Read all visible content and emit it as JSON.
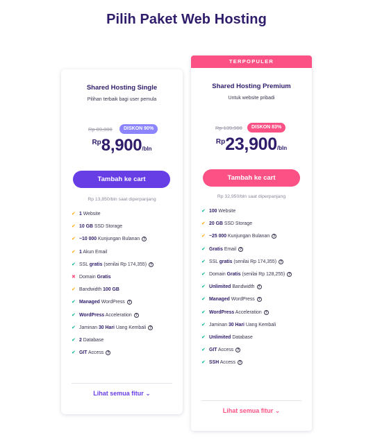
{
  "page": {
    "title": "Pilih Paket Web Hosting"
  },
  "colors": {
    "brand_purple": "#673de6",
    "accent_pink": "#fc5185",
    "title_navy": "#2f1c6a",
    "check_green": "#00b090",
    "check_orange": "#ffa800"
  },
  "plans": [
    {
      "name": "Shared Hosting Single",
      "description": "Pilihan terbaik bagi user pemula",
      "old_price": "Rp 89,000",
      "discount": "DISKON 90%",
      "currency": "Rp",
      "price": "8,900",
      "period": "/bln",
      "cta": "Tambah ke cart",
      "renewal": "Rp 13,850/bln saat diperpanjang",
      "see_all": "Lihat semua fitur",
      "features": [
        {
          "icon": "orange-check-icon",
          "bold": "1",
          "text": " Website",
          "help": false
        },
        {
          "icon": "orange-check-icon",
          "bold": "10 GB",
          "text": " SSD Storage",
          "help": false
        },
        {
          "icon": "orange-check-icon",
          "bold": "~10 000",
          "text": " Kunjungan Bulanan",
          "help": true
        },
        {
          "icon": "orange-check-icon",
          "bold": "1",
          "text": " Akun Email",
          "help": false
        },
        {
          "icon": "green-check-icon",
          "pre": "SSL ",
          "bold": "gratis",
          "text": " (senilai Rp 174,355)",
          "help": true
        },
        {
          "icon": "red-cross-icon",
          "pre": "Domain ",
          "bold": "Gratis",
          "text": "",
          "help": false
        },
        {
          "icon": "orange-check-icon",
          "pre": "Bandwidth ",
          "bold": "100 GB",
          "text": "",
          "help": false
        },
        {
          "icon": "green-check-icon",
          "bold": "Managed",
          "text": " WordPress",
          "help": true
        },
        {
          "icon": "green-check-icon",
          "bold": "WordPress",
          "text": " Acceleration",
          "help": true
        },
        {
          "icon": "green-check-icon",
          "pre": "Jaminan ",
          "bold": "30 Hari",
          "text": " Uang Kembali",
          "help": true
        },
        {
          "icon": "green-check-icon",
          "bold": "2",
          "text": " Database",
          "help": false
        },
        {
          "icon": "green-check-icon",
          "bold": "GIT",
          "text": " Access",
          "help": true
        }
      ]
    },
    {
      "ribbon": "TERPOPULER",
      "name": "Shared Hosting Premium",
      "description": "Untuk website pribadi",
      "old_price": "Rp 139,900",
      "discount": "DISKON 83%",
      "currency": "Rp",
      "price": "23,900",
      "period": "/bln",
      "cta": "Tambah ke cart",
      "renewal": "Rp 32,950/bln saat diperpanjang",
      "see_all": "Lihat semua fitur",
      "features": [
        {
          "icon": "green-check-icon",
          "bold": "100",
          "text": " Website",
          "help": false
        },
        {
          "icon": "orange-check-icon",
          "bold": "20 GB",
          "text": " SSD Storage",
          "help": false
        },
        {
          "icon": "orange-check-icon",
          "bold": "~25 000",
          "text": " Kunjungan Bulanan",
          "help": true
        },
        {
          "icon": "green-check-icon",
          "bold": "Gratis",
          "text": " Email",
          "help": true
        },
        {
          "icon": "green-check-icon",
          "pre": "SSL ",
          "bold": "gratis",
          "text": " (senilai Rp 174,355)",
          "help": true
        },
        {
          "icon": "green-check-icon",
          "pre": "Domain ",
          "bold": "Gratis",
          "text": " (senilai Rp 128,255)",
          "help": true
        },
        {
          "icon": "green-check-icon",
          "bold": "Unlimited",
          "text": " Bandwidth",
          "help": true
        },
        {
          "icon": "green-check-icon",
          "bold": "Managed",
          "text": " WordPress",
          "help": true
        },
        {
          "icon": "green-check-icon",
          "bold": "WordPress",
          "text": " Acceleration",
          "help": true
        },
        {
          "icon": "green-check-icon",
          "pre": "Jaminan ",
          "bold": "30 Hari",
          "text": " Uang Kembali",
          "help": false
        },
        {
          "icon": "green-check-icon",
          "bold": "Unlimited",
          "text": " Database",
          "help": false
        },
        {
          "icon": "green-check-icon",
          "bold": "GIT",
          "text": " Access",
          "help": true
        },
        {
          "icon": "green-check-icon",
          "bold": "SSH",
          "text": " Access",
          "help": true
        }
      ]
    }
  ]
}
